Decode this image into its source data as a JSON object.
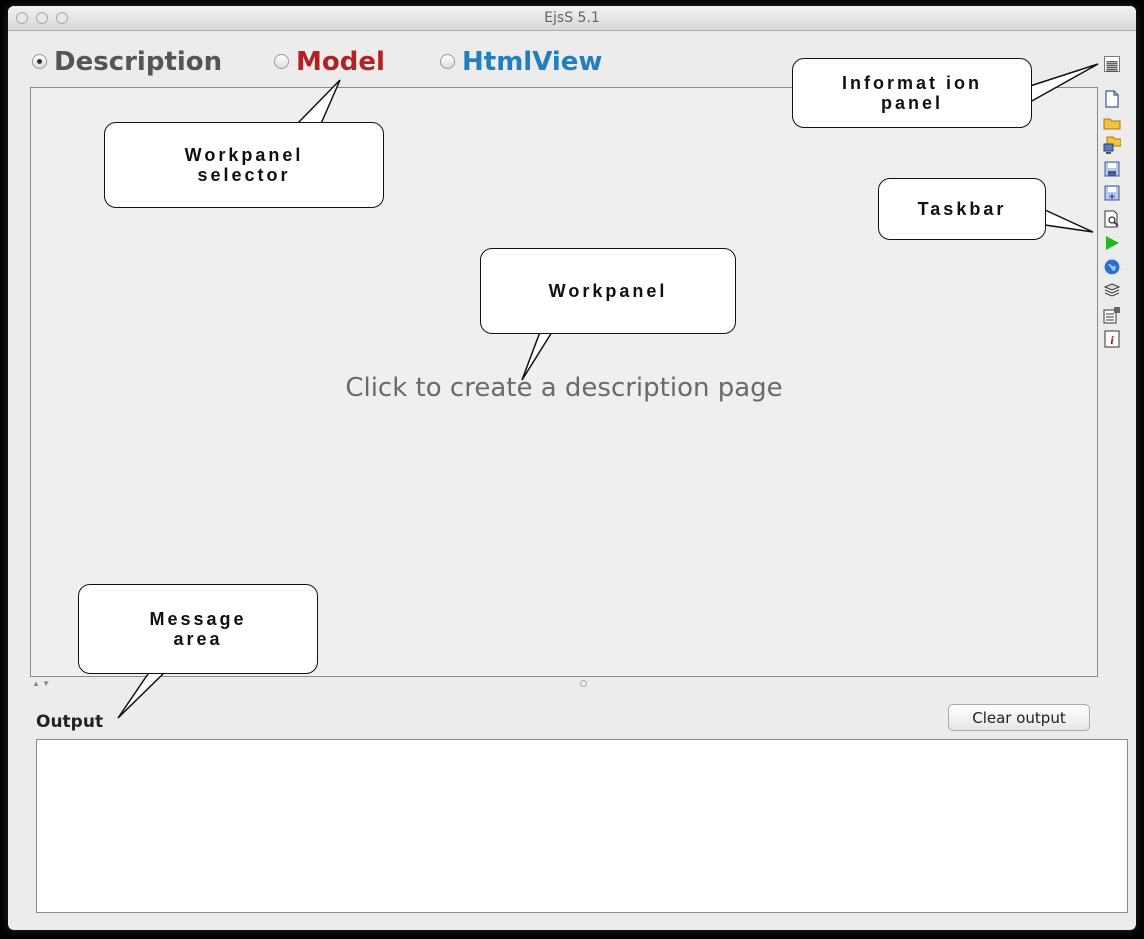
{
  "window": {
    "title": "EjsS 5.1"
  },
  "selector": {
    "options": [
      {
        "label": "Description",
        "color": "#555555",
        "checked": true
      },
      {
        "label": "Model",
        "color": "#b22222",
        "checked": false
      },
      {
        "label": "HtmlView",
        "color": "#1f7fc0",
        "checked": false
      }
    ]
  },
  "workpanel": {
    "placeholder": "Click to create a description page"
  },
  "taskbar": {
    "buttons": [
      "new-file-icon",
      "open-folder-icon",
      "open-remote-icon",
      "save-icon",
      "save-as-icon",
      "search-icon",
      "run-icon",
      "web-icon",
      "package-icon",
      "options-icon",
      "info-icon"
    ]
  },
  "info_panel_button": "information-panel-icon",
  "output": {
    "label": "Output",
    "clear_label": "Clear output"
  },
  "callouts": {
    "information_panel": "Informat ion\npanel",
    "workpanel_selector": "Workpanel\nselector",
    "taskbar": "Taskbar",
    "workpanel": "Workpanel",
    "message_area": "Message\narea"
  }
}
